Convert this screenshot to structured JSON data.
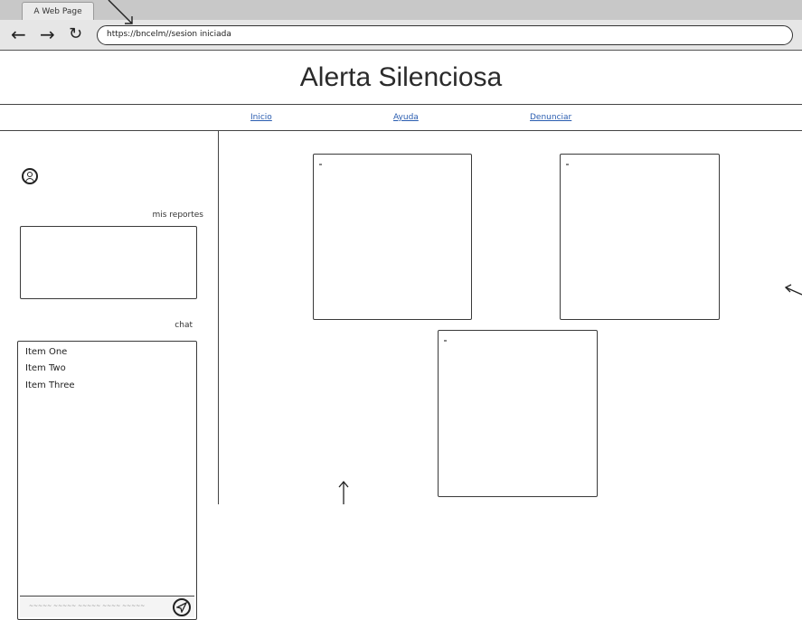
{
  "browser": {
    "tab_title": "A Web Page",
    "url": "https://bncelm//sesion iniciada"
  },
  "header": {
    "title": "Alerta Silenciosa"
  },
  "nav": {
    "items": [
      "Inicio",
      "Ayuda",
      "Denunciar"
    ]
  },
  "sidebar": {
    "reports_label": "mis reportes",
    "chat_label": "chat",
    "chat_items": [
      "Item One",
      "Item Two",
      "Item Three"
    ]
  }
}
